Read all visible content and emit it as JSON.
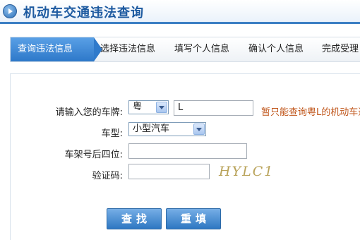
{
  "header": {
    "title": "机动车交通违法查询",
    "icon": "play-circle-icon"
  },
  "steps": [
    {
      "label": "查询违法信息",
      "active": true
    },
    {
      "label": "选择违法信息",
      "active": false
    },
    {
      "label": "填写个人信息",
      "active": false
    },
    {
      "label": "确认个人信息",
      "active": false
    },
    {
      "label": "完成受理",
      "active": false
    }
  ],
  "form": {
    "plate_label": "请输入您的车牌:",
    "province_value": "粤",
    "plate_value": "L",
    "plate_hint": "暂只能查询粤L的机动车违",
    "type_label": "车型:",
    "type_value": "小型汽车",
    "frame_label": "车架号后四位:",
    "frame_value": "",
    "code_label": "验证码:",
    "code_value": "",
    "captcha_text": "HYLC1"
  },
  "buttons": {
    "search": "查找",
    "reset": "重填"
  },
  "colors": {
    "accent": "#2d78c9",
    "hint": "#c0561b",
    "title": "#1d5aa0"
  }
}
